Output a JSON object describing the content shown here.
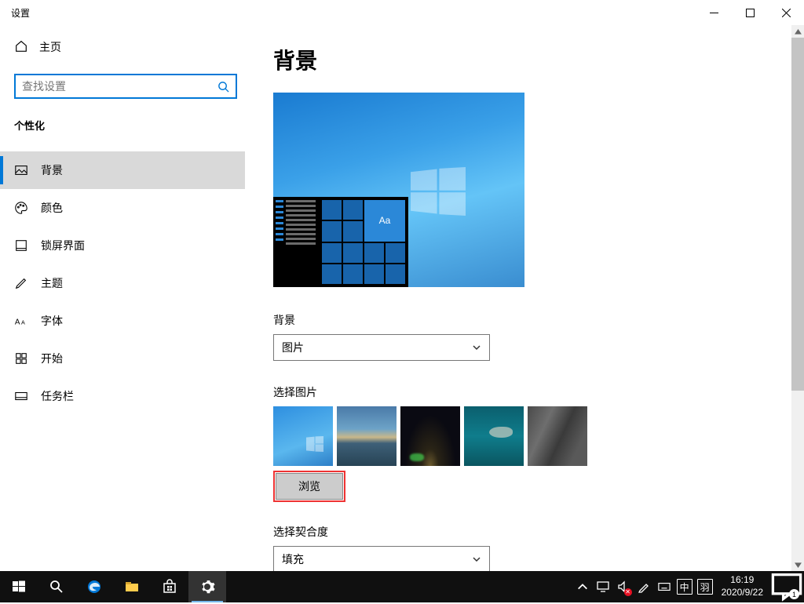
{
  "window": {
    "title": "设置"
  },
  "sidebar": {
    "home": "主页",
    "search_placeholder": "查找设置",
    "section": "个性化",
    "items": [
      {
        "label": "背景"
      },
      {
        "label": "颜色"
      },
      {
        "label": "锁屏界面"
      },
      {
        "label": "主题"
      },
      {
        "label": "字体"
      },
      {
        "label": "开始"
      },
      {
        "label": "任务栏"
      }
    ]
  },
  "main": {
    "heading": "背景",
    "preview_tile_text": "Aa",
    "bg_label": "背景",
    "bg_dropdown": "图片",
    "choose_label": "选择图片",
    "browse": "浏览",
    "fit_label": "选择契合度",
    "fit_dropdown": "填充"
  },
  "taskbar": {
    "ime1": "中",
    "ime2": "羽",
    "time": "16:19",
    "date": "2020/9/22",
    "notif_count": "1"
  }
}
